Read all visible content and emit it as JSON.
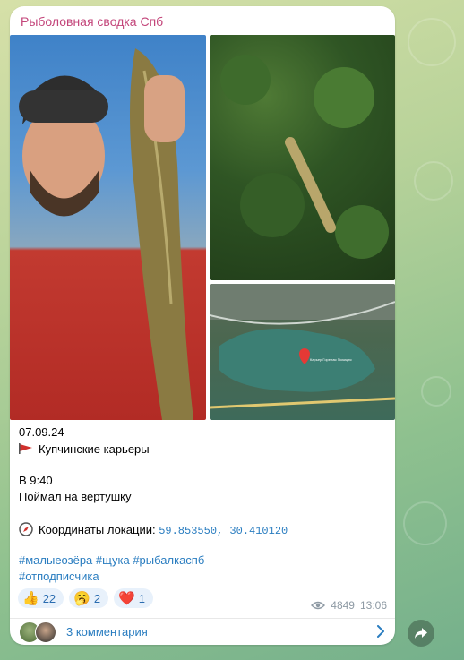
{
  "post": {
    "channel_name": "Рыболовная сводка Спб",
    "date_line": "07.09.24",
    "place": "Купчинские карьеры",
    "time_line": "В 9:40",
    "catch_line": "Поймал на вертушку",
    "coords_label": "Координаты локации: ",
    "coord_lat": "59.853550,",
    "coord_lon": "30.410120",
    "hashtags_line1": [
      "#малыеозёра",
      "#щука",
      "#рыбалкаспб"
    ],
    "hashtag_line2": "#отподписчика",
    "map_label": "Карьер Горелая Позиция"
  },
  "reactions": [
    {
      "emoji": "👍",
      "count": "22"
    },
    {
      "emoji": "🥱",
      "count": "2"
    },
    {
      "emoji": "❤️",
      "count": "1"
    }
  ],
  "meta": {
    "views": "4849",
    "time": "13:06"
  },
  "comments": {
    "label": "3 комментария"
  },
  "icons": {
    "flag": "red-flag-icon",
    "compass": "compass-icon",
    "eye": "eye-icon",
    "chevron": "chevron-right-icon",
    "share": "share-arrow-icon"
  },
  "colors": {
    "channel": "#c3457a",
    "link": "#2a7dc0",
    "reaction_bg": "#e8f1fb"
  }
}
